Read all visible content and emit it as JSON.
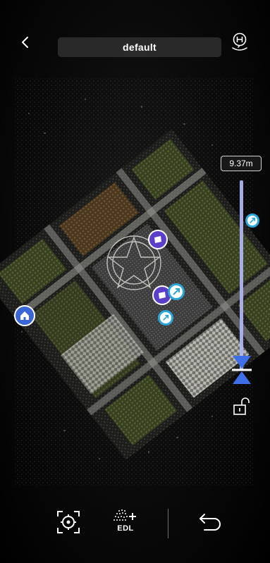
{
  "header": {
    "title": "default"
  },
  "altitude": {
    "label": "9.37m"
  },
  "toolbar": {
    "edl_label": "EDL"
  },
  "icons": {
    "back": "chevron-left-icon",
    "home_point": "home-point-location-icon",
    "lock": "unlock-icon",
    "recenter": "recenter-target-icon",
    "edl": "edl-points-icon",
    "undo": "undo-arrow-icon"
  },
  "colors": {
    "accent": "#3f5fe0",
    "marker_purple": "#5b3fc8",
    "marker_cyan": "#2aa6d8",
    "slider_track": "#aeb4f0"
  }
}
